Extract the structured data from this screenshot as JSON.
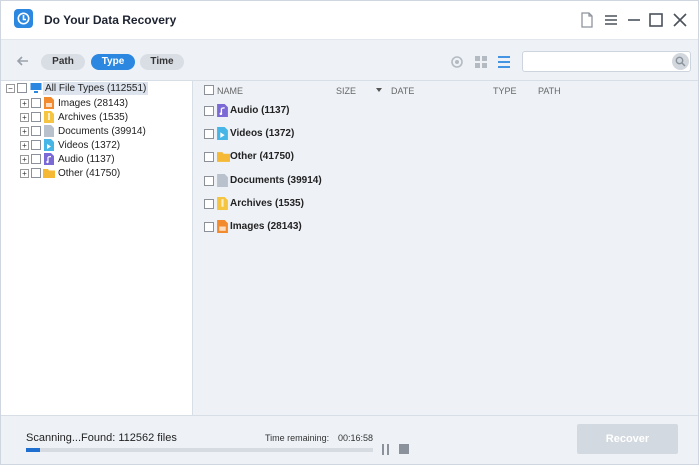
{
  "app": {
    "title": "Do Your Data Recovery",
    "accent_color": "#2b87e0"
  },
  "window_controls": [
    "document-icon",
    "menu-icon",
    "minimize-icon",
    "maximize-icon",
    "close-icon"
  ],
  "toolbar": {
    "tabs": [
      {
        "label": "Path",
        "active": false
      },
      {
        "label": "Type",
        "active": true
      },
      {
        "label": "Time",
        "active": false
      }
    ],
    "view_icons": [
      "preview-icon",
      "grid-view-icon",
      "list-view-icon"
    ],
    "search": {
      "value": "",
      "placeholder": ""
    }
  },
  "tree": {
    "root": {
      "label": "All File Types (112551)",
      "icon": "computer-icon"
    },
    "items": [
      {
        "label": "Images (28143)",
        "icon": "image-file-icon",
        "color": "#f28a2e"
      },
      {
        "label": "Archives (1535)",
        "icon": "archive-file-icon",
        "color": "#f5c542"
      },
      {
        "label": "Documents (39914)",
        "icon": "document-file-icon",
        "color": "#b9c2cc"
      },
      {
        "label": "Videos (1372)",
        "icon": "video-file-icon",
        "color": "#47b6e6"
      },
      {
        "label": "Audio (1137)",
        "icon": "audio-file-icon",
        "color": "#7b6ad6"
      },
      {
        "label": "Other (41750)",
        "icon": "folder-icon",
        "color": "#f5b935"
      }
    ]
  },
  "list": {
    "columns": [
      "NAME",
      "SIZE",
      "DATE",
      "TYPE",
      "PATH"
    ],
    "rows": [
      {
        "label": "Audio (1137)",
        "icon": "audio-file-icon",
        "color": "#7b6ad6"
      },
      {
        "label": "Videos (1372)",
        "icon": "video-file-icon",
        "color": "#47b6e6"
      },
      {
        "label": "Other (41750)",
        "icon": "folder-icon",
        "color": "#f5b935"
      },
      {
        "label": "Documents (39914)",
        "icon": "document-file-icon",
        "color": "#b9c2cc"
      },
      {
        "label": "Archives (1535)",
        "icon": "archive-file-icon",
        "color": "#f5c542"
      },
      {
        "label": "Images (28143)",
        "icon": "image-file-icon",
        "color": "#f28a2e"
      }
    ]
  },
  "status": {
    "scan_text": "Scanning...Found: 112562 files",
    "time_label": "Time remaining:",
    "time_value": "00:16:58",
    "progress_fraction": 0.04,
    "recover_label": "Recover"
  }
}
